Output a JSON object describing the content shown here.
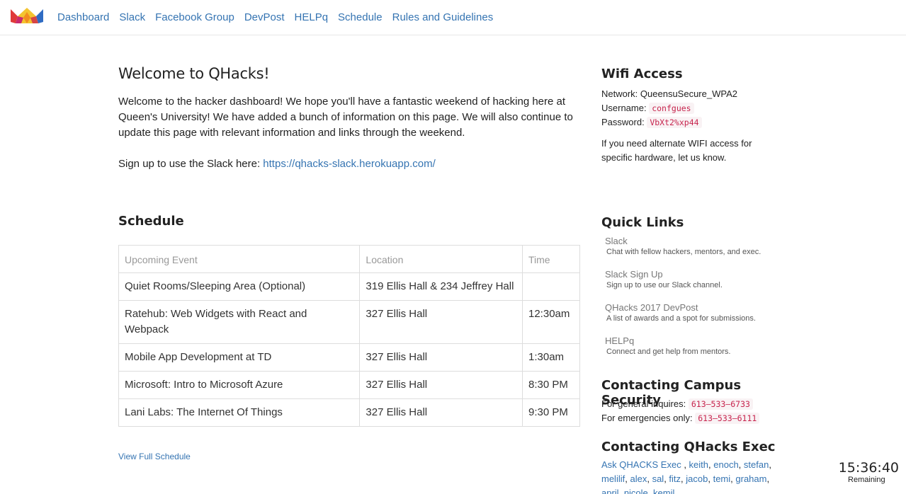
{
  "nav": {
    "logo_icon": "crown-logo-icon",
    "links": [
      "Dashboard",
      "Slack",
      "Facebook Group",
      "DevPost",
      "HELPq",
      "Schedule",
      "Rules and Guidelines"
    ]
  },
  "welcome": {
    "title": "Welcome to QHacks!",
    "text": "Welcome to the hacker dashboard! We hope you'll have a fantastic weekend of hacking here at Queen's University! We have added a bunch of information on this page. We will also continue to update this page with relevant information and links through the weekend.",
    "slack_prefix": "Sign up to use the Slack here: ",
    "slack_link": "https://qhacks-slack.herokuapp.com/"
  },
  "schedule": {
    "title": "Schedule",
    "headers": [
      "Upcoming Event",
      "Location",
      "Time"
    ],
    "rows": [
      {
        "event": "Quiet Rooms/Sleeping Area (Optional)",
        "location": "319 Ellis Hall & 234 Jeffrey Hall",
        "time": ""
      },
      {
        "event": "Ratehub: Web Widgets with React and Webpack",
        "location": "327 Ellis Hall",
        "time": "12:30am"
      },
      {
        "event": "Mobile App Development at TD",
        "location": "327 Ellis Hall",
        "time": "1:30am"
      },
      {
        "event": "Microsoft: Intro to Microsoft Azure",
        "location": "327 Ellis Hall",
        "time": "8:30 PM"
      },
      {
        "event": "Lani Labs: The Internet Of Things",
        "location": "327 Ellis Hall",
        "time": "9:30 PM"
      }
    ],
    "view_full": "View Full Schedule"
  },
  "wifi": {
    "title": "Wifi Access",
    "network_label": "Network: ",
    "network": "QueensuSecure_WPA2",
    "username_label": "Username: ",
    "username": "confgues",
    "password_label": "Password: ",
    "password": "VbXt2%xp44",
    "note": "If you need alternate WIFI access for specific hardware, let us know."
  },
  "quick_links": {
    "title": "Quick Links",
    "items": [
      {
        "name": "Slack",
        "desc": "Chat with fellow hackers, mentors, and exec."
      },
      {
        "name": "Slack Sign Up",
        "desc": "Sign up to use our Slack channel."
      },
      {
        "name": "QHacks 2017 DevPost",
        "desc": "A list of awards and a spot for submissions."
      },
      {
        "name": "HELPq",
        "desc": "Connect and get help from mentors."
      }
    ]
  },
  "security": {
    "title": "Contacting Campus Security",
    "general_label": "For general inquires: ",
    "general_phone": "613–533–6733",
    "emergency_label": "For emergencies only: ",
    "emergency_phone": "613–533–6111"
  },
  "exec": {
    "title": "Contacting QHacks Exec",
    "contacts": [
      "Ask QHACKS Exec",
      "keith",
      "enoch",
      "stefan",
      "melilif",
      "alex",
      "sal",
      "fitz",
      "jacob",
      "temi",
      "graham",
      "april",
      "nicole",
      "kemil"
    ]
  },
  "timer": {
    "time": "15:36:40",
    "label": "Remaining"
  },
  "colors": {
    "link": "#3574b2",
    "code_text": "#c7254e",
    "code_bg": "#f9f2f4"
  }
}
